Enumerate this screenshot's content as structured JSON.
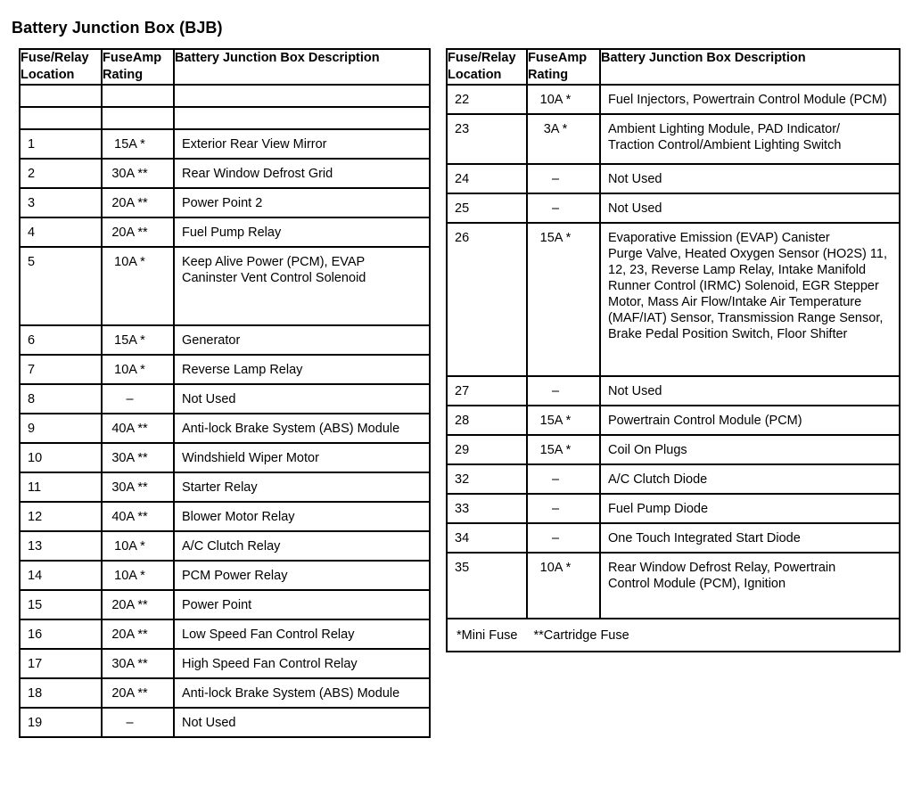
{
  "page": {
    "title": "Battery Junction Box (BJB)"
  },
  "columns": {
    "location": "Fuse/Relay\nLocation",
    "amp": "FuseAmp\nRating",
    "description": "Battery Junction Box Description"
  },
  "left_table": {
    "rows": [
      {
        "location": "",
        "amp": "",
        "description": "",
        "blank": true
      },
      {
        "location": "",
        "amp": "",
        "description": "",
        "blank": true
      },
      {
        "location": "1",
        "amp": "15A *",
        "description": "Exterior Rear View Mirror"
      },
      {
        "location": "2",
        "amp": "30A **",
        "description": "Rear Window Defrost Grid"
      },
      {
        "location": "3",
        "amp": "20A **",
        "description": "Power Point 2"
      },
      {
        "location": "4",
        "amp": "20A **",
        "description": "Fuel Pump Relay"
      },
      {
        "location": "5",
        "amp": "10A *",
        "description": "Keep Alive Power (PCM), EVAP\nCaninster Vent Control Solenoid"
      },
      {
        "location": "6",
        "amp": "15A *",
        "description": "Generator"
      },
      {
        "location": "7",
        "amp": "10A *",
        "description": "Reverse Lamp Relay"
      },
      {
        "location": "8",
        "amp": "–",
        "description": "Not Used"
      },
      {
        "location": "9",
        "amp": "40A **",
        "description": "Anti-lock Brake System (ABS) Module"
      },
      {
        "location": "10",
        "amp": "30A **",
        "description": "Windshield Wiper Motor"
      },
      {
        "location": "11",
        "amp": "30A **",
        "description": "Starter Relay"
      },
      {
        "location": "12",
        "amp": "40A **",
        "description": "Blower Motor Relay"
      },
      {
        "location": "13",
        "amp": "10A *",
        "description": "A/C Clutch Relay"
      },
      {
        "location": "14",
        "amp": "10A *",
        "description": "PCM Power Relay"
      },
      {
        "location": "15",
        "amp": "20A **",
        "description": "Power Point"
      },
      {
        "location": "16",
        "amp": "20A **",
        "description": "Low Speed Fan Control Relay"
      },
      {
        "location": "17",
        "amp": "30A **",
        "description": "High Speed Fan Control Relay"
      },
      {
        "location": "18",
        "amp": "20A **",
        "description": "Anti-lock Brake System (ABS) Module"
      },
      {
        "location": "19",
        "amp": "–",
        "description": "Not Used"
      }
    ]
  },
  "right_table": {
    "rows": [
      {
        "location": "22",
        "amp": "10A *",
        "description": "Fuel Injectors, Powertrain Control Module (PCM)"
      },
      {
        "location": "23",
        "amp": "3A *",
        "description": "Ambient Lighting Module, PAD Indicator/\nTraction Control/Ambient Lighting Switch"
      },
      {
        "location": "24",
        "amp": "–",
        "description": "Not Used"
      },
      {
        "location": "25",
        "amp": "–",
        "description": "Not Used"
      },
      {
        "location": "26",
        "amp": "15A *",
        "description": "Evaporative Emission (EVAP) Canister\nPurge Valve, Heated Oxygen Sensor (HO2S) 11,\n12, 23, Reverse Lamp Relay, Intake Manifold\nRunner Control (IRMC) Solenoid, EGR Stepper\nMotor, Mass Air Flow/Intake Air Temperature\n(MAF/IAT) Sensor, Transmission Range Sensor,\nBrake Pedal Position Switch, Floor Shifter"
      },
      {
        "location": "27",
        "amp": "–",
        "description": "Not Used"
      },
      {
        "location": "28",
        "amp": "15A *",
        "description": "Powertrain Control Module (PCM)"
      },
      {
        "location": "29",
        "amp": "15A *",
        "description": "Coil On Plugs"
      },
      {
        "location": "32",
        "amp": "–",
        "description": "A/C Clutch Diode"
      },
      {
        "location": "33",
        "amp": "–",
        "description": "Fuel Pump Diode"
      },
      {
        "location": "34",
        "amp": "–",
        "description": "One Touch Integrated Start Diode"
      },
      {
        "location": "35",
        "amp": "10A *",
        "description": "Rear Window Defrost Relay, Powertrain\nControl Module (PCM), Ignition"
      }
    ],
    "footnote": {
      "mini": "*Mini Fuse",
      "cartridge": "**Cartridge Fuse"
    }
  }
}
